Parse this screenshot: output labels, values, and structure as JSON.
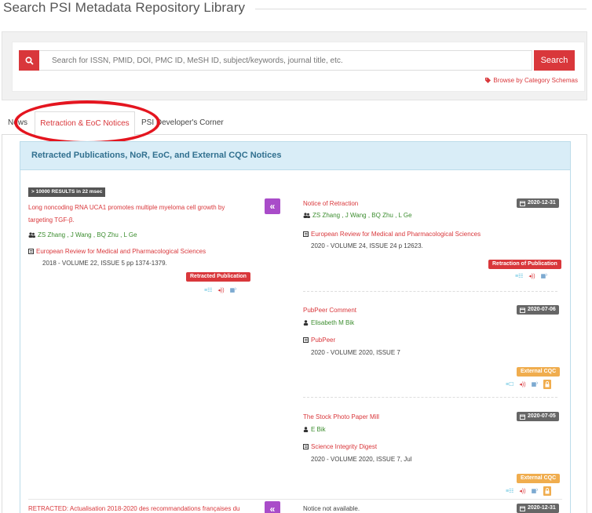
{
  "header": {
    "title": "Search PSI Metadata Repository Library"
  },
  "search": {
    "placeholder": "Search for ISSN, PMID, DOI, PMC ID, MeSH ID, subject/keywords, journal title, etc.",
    "button_label": "Search",
    "browse_label": "Browse by Category Schemas"
  },
  "tabs": [
    {
      "label": "News"
    },
    {
      "label": "Retraction & EoC Notices",
      "active": true
    },
    {
      "label": "PSI Developer's Corner"
    }
  ],
  "panel": {
    "title": "Retracted Publications, NoR, EoC, and External CQC Notices",
    "results_badge": "> 10000 RESULTS in 22 msec"
  },
  "results": [
    {
      "publication": {
        "title_line1": "Long noncoding RNA UCA1 promotes multiple myeloma cell growth by",
        "title_line2": "targeting TGF-β.",
        "authors": "ZS Zhang , J Wang , BQ Zhu , L Ge",
        "journal": "European Review for Medical and Pharmacological Sciences",
        "volume": "2018 - VOLUME 22, ISSUE 5 pp 1374-1379.",
        "label": "Retracted Publication"
      },
      "notices": [
        {
          "title": "Notice of Retraction",
          "date": "2020-12-31",
          "people": "ZS Zhang , J Wang , BQ Zhu , L Ge",
          "journal": "European Review for Medical and Pharmacological Sciences",
          "volume": "2020 - VOLUME 24, ISSUE 24 p 12623.",
          "label": "Retraction of Publication"
        },
        {
          "title": "PubPeer Comment",
          "date": "2020-07-06",
          "people": "Elisabeth M Bik",
          "journal": "PubPeer",
          "volume": "2020 - VOLUME 2020, ISSUE 7",
          "label": "External CQC"
        },
        {
          "title": "The Stock Photo Paper Mill",
          "date": "2020-07-05",
          "people": "E Bik",
          "journal": "Science Integrity Digest",
          "volume": "2020 - VOLUME 2020, ISSUE 7, Jul",
          "label": "External CQC"
        }
      ]
    },
    {
      "publication": {
        "title_line1": "RETRACTED: Actualisation 2018-2020 des recommandations françaises du"
      },
      "notices": [
        {
          "title": "Notice not available.",
          "date": "2020-12-31"
        }
      ]
    }
  ],
  "icons": {
    "search": "magnifier-icon",
    "browse": "tags-icon",
    "authors": "users-icon",
    "journal": "book-icon",
    "date": "calendar-icon",
    "collapse": "double-chevron-left-icon"
  },
  "colors": {
    "accent_red": "#d9373b",
    "author_green": "#3c8d2f",
    "panel_blue": "#d9edf7",
    "collapse_purple": "#a94cc9",
    "label_orange": "#f0ad4e",
    "highlight_ellipse": "#e4151f"
  }
}
